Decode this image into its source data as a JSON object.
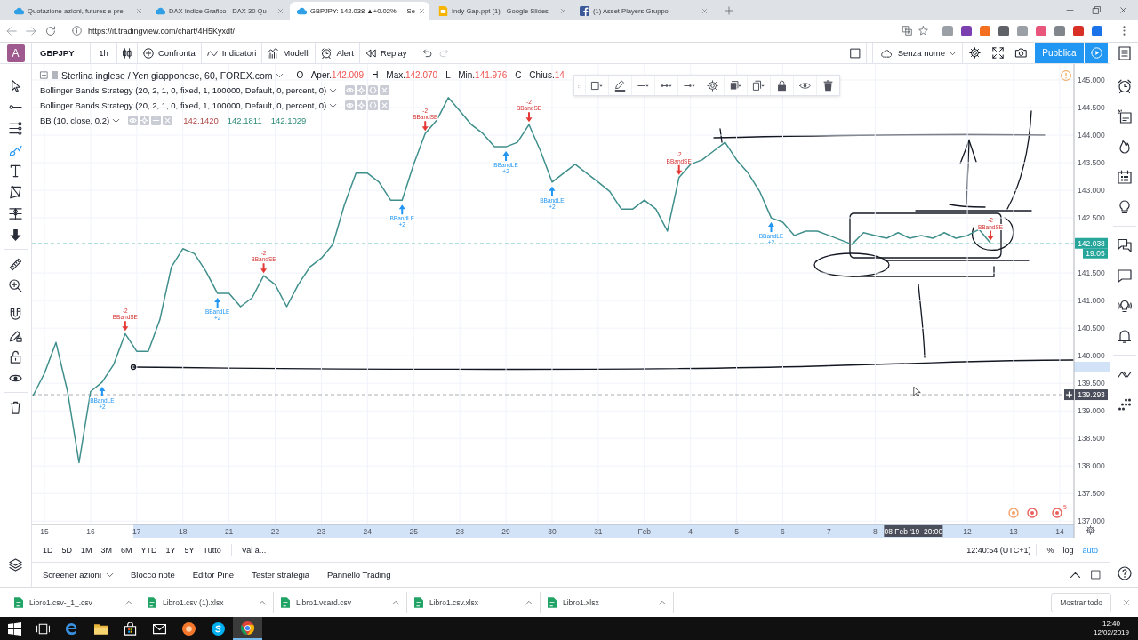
{
  "browser": {
    "tabs": [
      {
        "title": "Quotazione azioni, futures e pre",
        "selected": false
      },
      {
        "title": "DAX Indice Grafico - DAX 30 Qu",
        "selected": false
      },
      {
        "title": "GBPJPY: 142.038 ▲+0.02% — Se",
        "selected": true
      },
      {
        "title": "Indy Gap.ppt (1) - Google Slides",
        "selected": false
      },
      {
        "title": "(1) Asset Players Gruppo",
        "selected": false
      }
    ],
    "address": "https://it.tradingview.com/chart/4H5Kyxdf/"
  },
  "toolbar": {
    "avatar": "A",
    "symbol": "GBPJPY",
    "interval": "1h",
    "buttons": [
      {
        "kind": "compare",
        "label": "Confronta"
      },
      {
        "kind": "indicators",
        "label": "Indicatori"
      },
      {
        "kind": "templates",
        "label": "Modelli"
      },
      {
        "kind": "alert",
        "label": "Alert"
      },
      {
        "kind": "replay",
        "label": "Replay"
      }
    ],
    "history": [
      {
        "kind": "undo",
        "disabled": false
      },
      {
        "kind": "redo",
        "disabled": true
      }
    ],
    "layout_name": "Senza nome",
    "publish": "Pubblica"
  },
  "left_tools": [
    {
      "kind": "cursor",
      "selected": false
    },
    {
      "kind": "trend-line",
      "selected": false
    },
    {
      "kind": "fib",
      "selected": false
    },
    {
      "kind": "brush",
      "selected": true
    },
    {
      "kind": "text",
      "selected": false
    },
    {
      "kind": "pattern",
      "selected": false
    },
    {
      "kind": "measure",
      "selected": false
    },
    {
      "kind": "arrow",
      "selected": false
    },
    {
      "kind": "ruler",
      "selected": false
    },
    {
      "kind": "zoom",
      "selected": false
    },
    {
      "kind": "magnet",
      "selected": false
    },
    {
      "kind": "stay-drawing",
      "selected": false
    },
    {
      "kind": "lock",
      "selected": false
    },
    {
      "kind": "hide",
      "selected": false
    },
    {
      "kind": "remove",
      "selected": false
    }
  ],
  "legend": {
    "ohlc": [
      {
        "label": "O - Aper.",
        "value": "142.009"
      },
      {
        "label": "H - Max.",
        "value": "142.070"
      },
      {
        "label": "L - Min.",
        "value": "141.976"
      },
      {
        "label": "C - Chius.",
        "value": "14"
      }
    ],
    "studies": [
      {
        "name": "Bollinger Bands Strategy (20, 2, 1, 0, fixed, 1, 100000, Default, 0, percent, 0)"
      },
      {
        "name": "Bollinger Bands Strategy (20, 2, 1, 0, fixed, 1, 100000, Default, 0, percent, 0)"
      },
      {
        "name": "BB (10, close, 0.2)",
        "values": [
          {
            "text": "142.1420",
            "color": "#b24a4a"
          },
          {
            "text": "142.1811",
            "color": "#2e8b7a"
          },
          {
            "text": "142.1029",
            "color": "#2e8b7a"
          }
        ]
      }
    ]
  },
  "chart": {
    "chart_data": {
      "type": "line",
      "grid": true,
      "categories": [
        null,
        "15",
        null,
        null,
        null,
        "16",
        null,
        null,
        null,
        "17",
        null,
        null,
        null,
        "18",
        null,
        null,
        null,
        "21",
        null,
        null,
        null,
        "22",
        null,
        null,
        null,
        "23",
        null,
        null,
        null,
        "24",
        null,
        null,
        null,
        "25",
        null,
        null,
        null,
        "28",
        null,
        null,
        null,
        "29",
        null,
        null,
        null,
        "30",
        null,
        null,
        null,
        "31",
        null,
        null,
        null,
        "Feb",
        null,
        null,
        null,
        "4",
        null,
        null,
        null,
        "5",
        null,
        null,
        null,
        "6",
        null,
        null,
        null,
        "7",
        null,
        null,
        null,
        "8",
        null,
        null,
        null,
        null,
        null,
        null,
        null,
        "12",
        null,
        null,
        null,
        "13",
        null,
        null,
        null,
        "14"
      ],
      "series": [
        {
          "name": "Sterlina inglese / Yen giapponese, 60, FOREX.com",
          "color": "#3f8f8c",
          "values": [
            139.27,
            139.68,
            140.24,
            139.35,
            138.06,
            139.35,
            139.52,
            139.84,
            140.4,
            140.08,
            140.08,
            140.65,
            141.61,
            141.94,
            141.85,
            141.53,
            141.13,
            141.13,
            140.89,
            141.05,
            141.45,
            141.29,
            140.89,
            141.29,
            141.61,
            141.77,
            142.02,
            142.74,
            143.31,
            143.31,
            143.15,
            142.82,
            142.82,
            143.47,
            144.03,
            144.27,
            144.68,
            144.44,
            144.19,
            144.03,
            143.79,
            143.79,
            143.87,
            144.19,
            143.71,
            143.15,
            143.31,
            143.47,
            143.31,
            143.15,
            142.98,
            142.66,
            142.66,
            142.82,
            142.66,
            142.26,
            143.23,
            143.47,
            143.55,
            143.71,
            143.87,
            143.55,
            143.31,
            142.98,
            142.5,
            142.42,
            142.18,
            142.26,
            142.26,
            142.18,
            142.1,
            142.02,
            142.23,
            142.18,
            142.13,
            142.23,
            142.13,
            142.18,
            142.13,
            142.23,
            142.13,
            142.18,
            142.29,
            142.04,
            null,
            null,
            null,
            null,
            null,
            null
          ]
        }
      ],
      "ylim": [
        136.94,
        145.29
      ],
      "yticks": [
        {
          "value": 145,
          "label": "145.000"
        },
        {
          "value": 144.5,
          "label": "144.500"
        },
        {
          "value": 144,
          "label": "144.000"
        },
        {
          "value": 143.5,
          "label": "143.500"
        },
        {
          "value": 143,
          "label": "143.000"
        },
        {
          "value": 142.5,
          "label": "142.500"
        },
        {
          "value": 141.5,
          "label": "141.500"
        },
        {
          "value": 141,
          "label": "141.000"
        },
        {
          "value": 140.5,
          "label": "140.500"
        },
        {
          "value": 140,
          "label": "140.000"
        },
        {
          "value": 139.5,
          "label": "139.500"
        },
        {
          "value": 139,
          "label": "139.000"
        },
        {
          "value": 138.5,
          "label": "138.500"
        },
        {
          "value": 138,
          "label": "138.000"
        },
        {
          "value": 137.5,
          "label": "137.500"
        },
        {
          "value": 137,
          "label": "137.000"
        }
      ],
      "annotations": [
        "BBandLE",
        "BBandSE",
        "BBandLE",
        "BBandSE",
        "BBandLE",
        "BBandSE",
        "BBandLE",
        "BBandSE",
        "BBandLE",
        "BBandSE",
        "BBandLE",
        "BBandSE"
      ],
      "ref_lines": [
        {
          "axis": "y",
          "value": 142.038,
          "label": "142.038",
          "color": "#26a69a"
        },
        {
          "axis": "y",
          "value": 139.293,
          "label": "139.293",
          "color": "#4a4e5a"
        }
      ]
    },
    "signals": [
      {
        "kind": "long",
        "qty": "+2"
      },
      {
        "kind": "short",
        "qty": "-2"
      },
      {
        "kind": "long",
        "qty": "+2"
      },
      {
        "kind": "short",
        "qty": "-2"
      },
      {
        "kind": "long",
        "qty": "+2"
      },
      {
        "kind": "short",
        "qty": "-2"
      },
      {
        "kind": "long",
        "qty": "+2"
      },
      {
        "kind": "short",
        "qty": "-2"
      },
      {
        "kind": "long",
        "qty": "+2"
      },
      {
        "kind": "short",
        "qty": "-2"
      },
      {
        "kind": "long",
        "qty": "+2"
      },
      {
        "kind": "short",
        "qty": "-2"
      }
    ],
    "countdown": "19:05",
    "crosshair_time": "08 Feb '19  20:00",
    "events_badge": "5"
  },
  "range_bar": {
    "ranges": [
      "1D",
      "5D",
      "1M",
      "3M",
      "6M",
      "YTD",
      "1Y",
      "5Y",
      "Tutto"
    ],
    "goto": "Vai a...",
    "clock": "12:40:54 (UTC+1)",
    "scale_options": [
      {
        "label": "%",
        "selected": false
      },
      {
        "label": "log",
        "selected": false
      },
      {
        "label": "auto",
        "selected": true
      }
    ]
  },
  "bottom_tabs": [
    {
      "label": "Screener azioni",
      "dropdown": true
    },
    {
      "label": "Blocco note",
      "dropdown": false
    },
    {
      "label": "Editor Pine",
      "dropdown": false
    },
    {
      "label": "Tester strategia",
      "dropdown": false
    },
    {
      "label": "Pannello Trading",
      "dropdown": false
    }
  ],
  "downloads": {
    "files": [
      "Libro1.csv-_1_.csv",
      "Libro1.csv (1).xlsx",
      "Libro1.vcard.csv",
      "Libro1.csv.xlsx",
      "Libro1.xlsx"
    ],
    "show_all": "Mostrar todo"
  },
  "taskbar": {
    "apps": [
      {
        "selected": false
      },
      {
        "selected": false
      },
      {
        "selected": false
      },
      {
        "selected": false
      },
      {
        "selected": false
      },
      {
        "selected": false
      },
      {
        "selected": true
      }
    ],
    "time": "12:40",
    "date": "12/02/2019"
  }
}
